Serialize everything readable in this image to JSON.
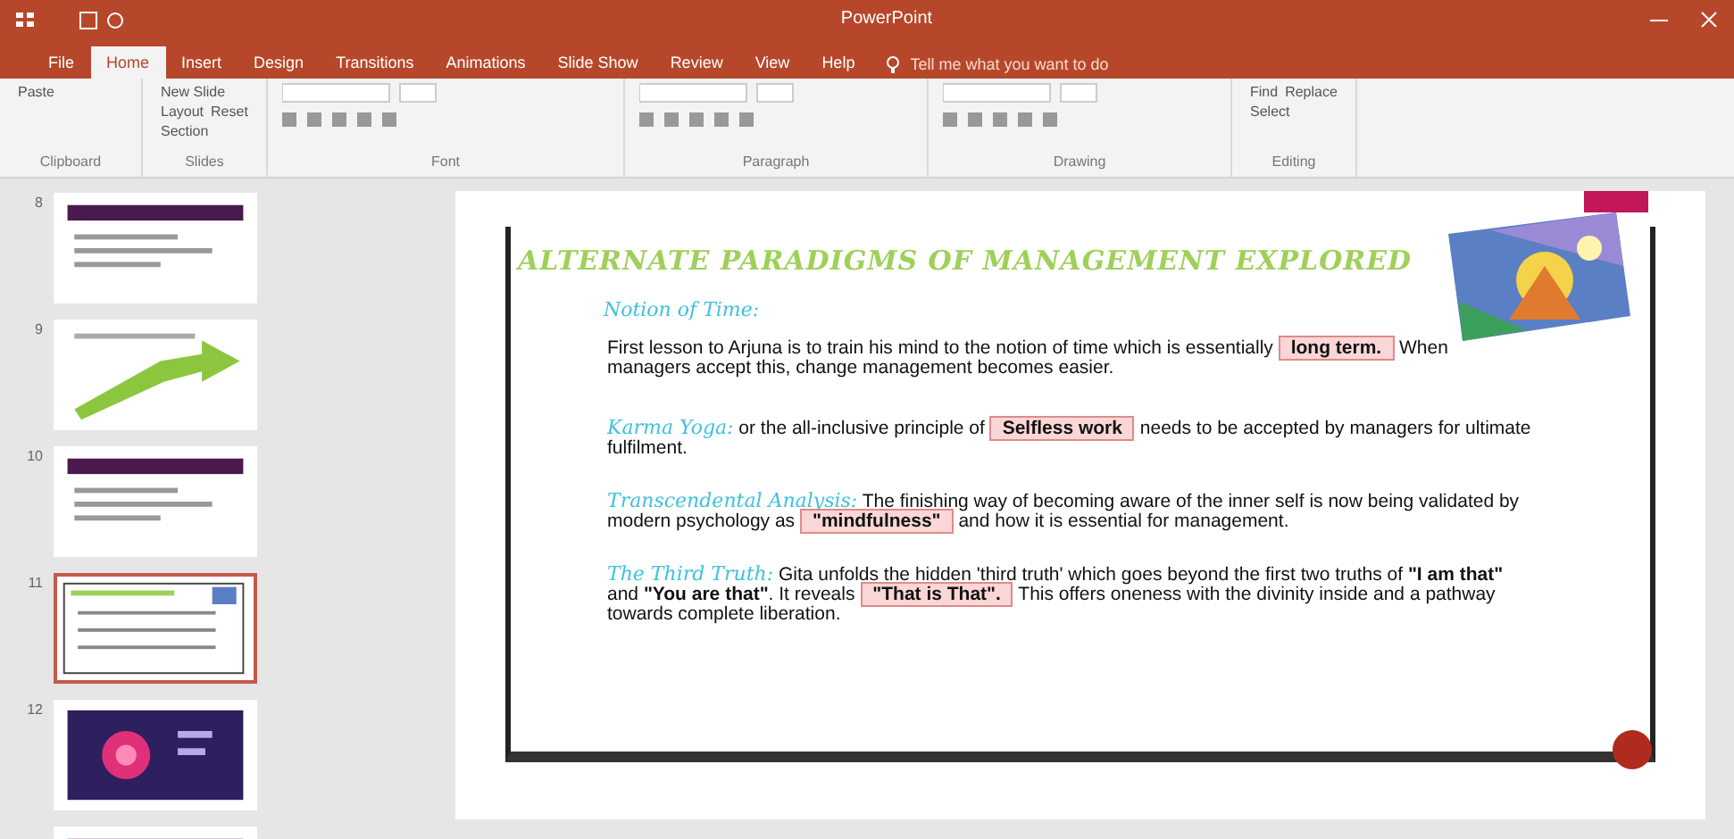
{
  "window": {
    "title": "PowerPoint"
  },
  "tabs": [
    {
      "label": "File",
      "selected": false
    },
    {
      "label": "Home",
      "selected": true
    },
    {
      "label": "Insert",
      "selected": false
    },
    {
      "label": "Design",
      "selected": false
    },
    {
      "label": "Transitions",
      "selected": false
    },
    {
      "label": "Animations",
      "selected": false
    },
    {
      "label": "Slide Show",
      "selected": false
    },
    {
      "label": "Review",
      "selected": false
    },
    {
      "label": "View",
      "selected": false
    },
    {
      "label": "Help",
      "selected": false
    }
  ],
  "tell_me": {
    "placeholder": "Tell me what you want to do"
  },
  "ribbon_groups": [
    {
      "label": "Clipboard",
      "buttons": [
        "Paste"
      ]
    },
    {
      "label": "Slides",
      "buttons": [
        "New Slide",
        "Layout",
        "Reset",
        "Section"
      ]
    },
    {
      "label": "Font"
    },
    {
      "label": "Paragraph"
    },
    {
      "label": "Drawing"
    },
    {
      "label": "Editing",
      "buttons": [
        "Find",
        "Replace",
        "Select"
      ]
    }
  ],
  "thumbnails": [
    {
      "number": "8",
      "kind": "header",
      "selected": false
    },
    {
      "number": "9",
      "kind": "arrow",
      "selected": false
    },
    {
      "number": "10",
      "kind": "header",
      "selected": false
    },
    {
      "number": "11",
      "kind": "current",
      "selected": true
    },
    {
      "number": "12",
      "kind": "dark",
      "selected": false
    },
    {
      "kind": "header",
      "selected": false
    }
  ],
  "slide": {
    "title": "ALTERNATE PARADIGMS OF MANAGEMENT EXPLORED",
    "points": [
      {
        "heading": "Notion of Time:",
        "before": "First lesson to Arjuna is to train his mind to the notion of time which is essentially",
        "highlight": "long term.",
        "after": "When managers accept this, change management becomes easier."
      },
      {
        "heading": "Karma Yoga:",
        "before": "or the all-inclusive principle of",
        "highlight": "Selfless work",
        "after": "needs to be accepted by managers for ultimate fulfilment."
      },
      {
        "heading": "Transcendental Analysis:",
        "before": "The finishing way of becoming aware of the inner self is now being validated by modern psychology as",
        "highlight": "\"mindfulness\"",
        "after": "and how it is essential for management."
      },
      {
        "heading": "The Third Truth:",
        "before": "Gita unfolds the hidden 'third truth' which goes beyond the first two truths of **\"I am that\"** and **\"You are that\"**. It reveals",
        "highlight": "\"That is That\".",
        "after": "This offers oneness with the divinity inside and a pathway towards complete liberation."
      }
    ]
  }
}
